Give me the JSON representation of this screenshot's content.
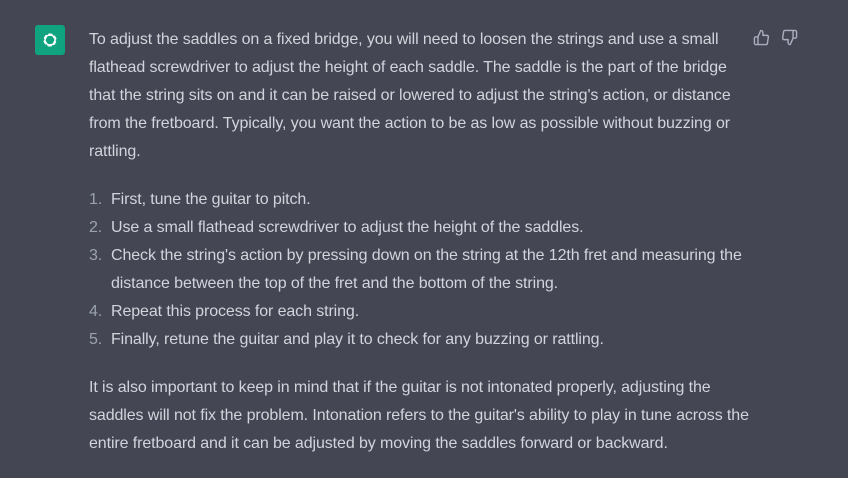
{
  "message": {
    "intro": "To adjust the saddles on a fixed bridge, you will need to loosen the strings and use a small flathead screwdriver to adjust the height of each saddle. The saddle is the part of the bridge that the string sits on and it can be raised or lowered to adjust the string's action, or distance from the fretboard. Typically, you want the action to be as low as possible without buzzing or rattling.",
    "steps": [
      {
        "num": "1.",
        "text": "First, tune the guitar to pitch."
      },
      {
        "num": "2.",
        "text": "Use a small flathead screwdriver to adjust the height of the saddles."
      },
      {
        "num": "3.",
        "text": "Check the string's action by pressing down on the string at the 12th fret and measuring the distance between the top of the fret and the bottom of the string."
      },
      {
        "num": "4.",
        "text": "Repeat this process for each string."
      },
      {
        "num": "5.",
        "text": "Finally, retune the guitar and play it to check for any buzzing or rattling."
      }
    ],
    "outro": "It is also important to keep in mind that if the guitar is not intonated properly, adjusting the saddles will not fix the problem. Intonation refers to the guitar's ability to play in tune across the entire fretboard and it can be adjusted by moving the saddles forward or backward."
  },
  "icons": {
    "avatar": "openai-logo-icon",
    "thumbs_up": "thumbs-up-icon",
    "thumbs_down": "thumbs-down-icon"
  },
  "colors": {
    "background": "#444654",
    "avatar_bg": "#10a37f",
    "text": "#d1d5db",
    "muted": "#9ca3af"
  }
}
